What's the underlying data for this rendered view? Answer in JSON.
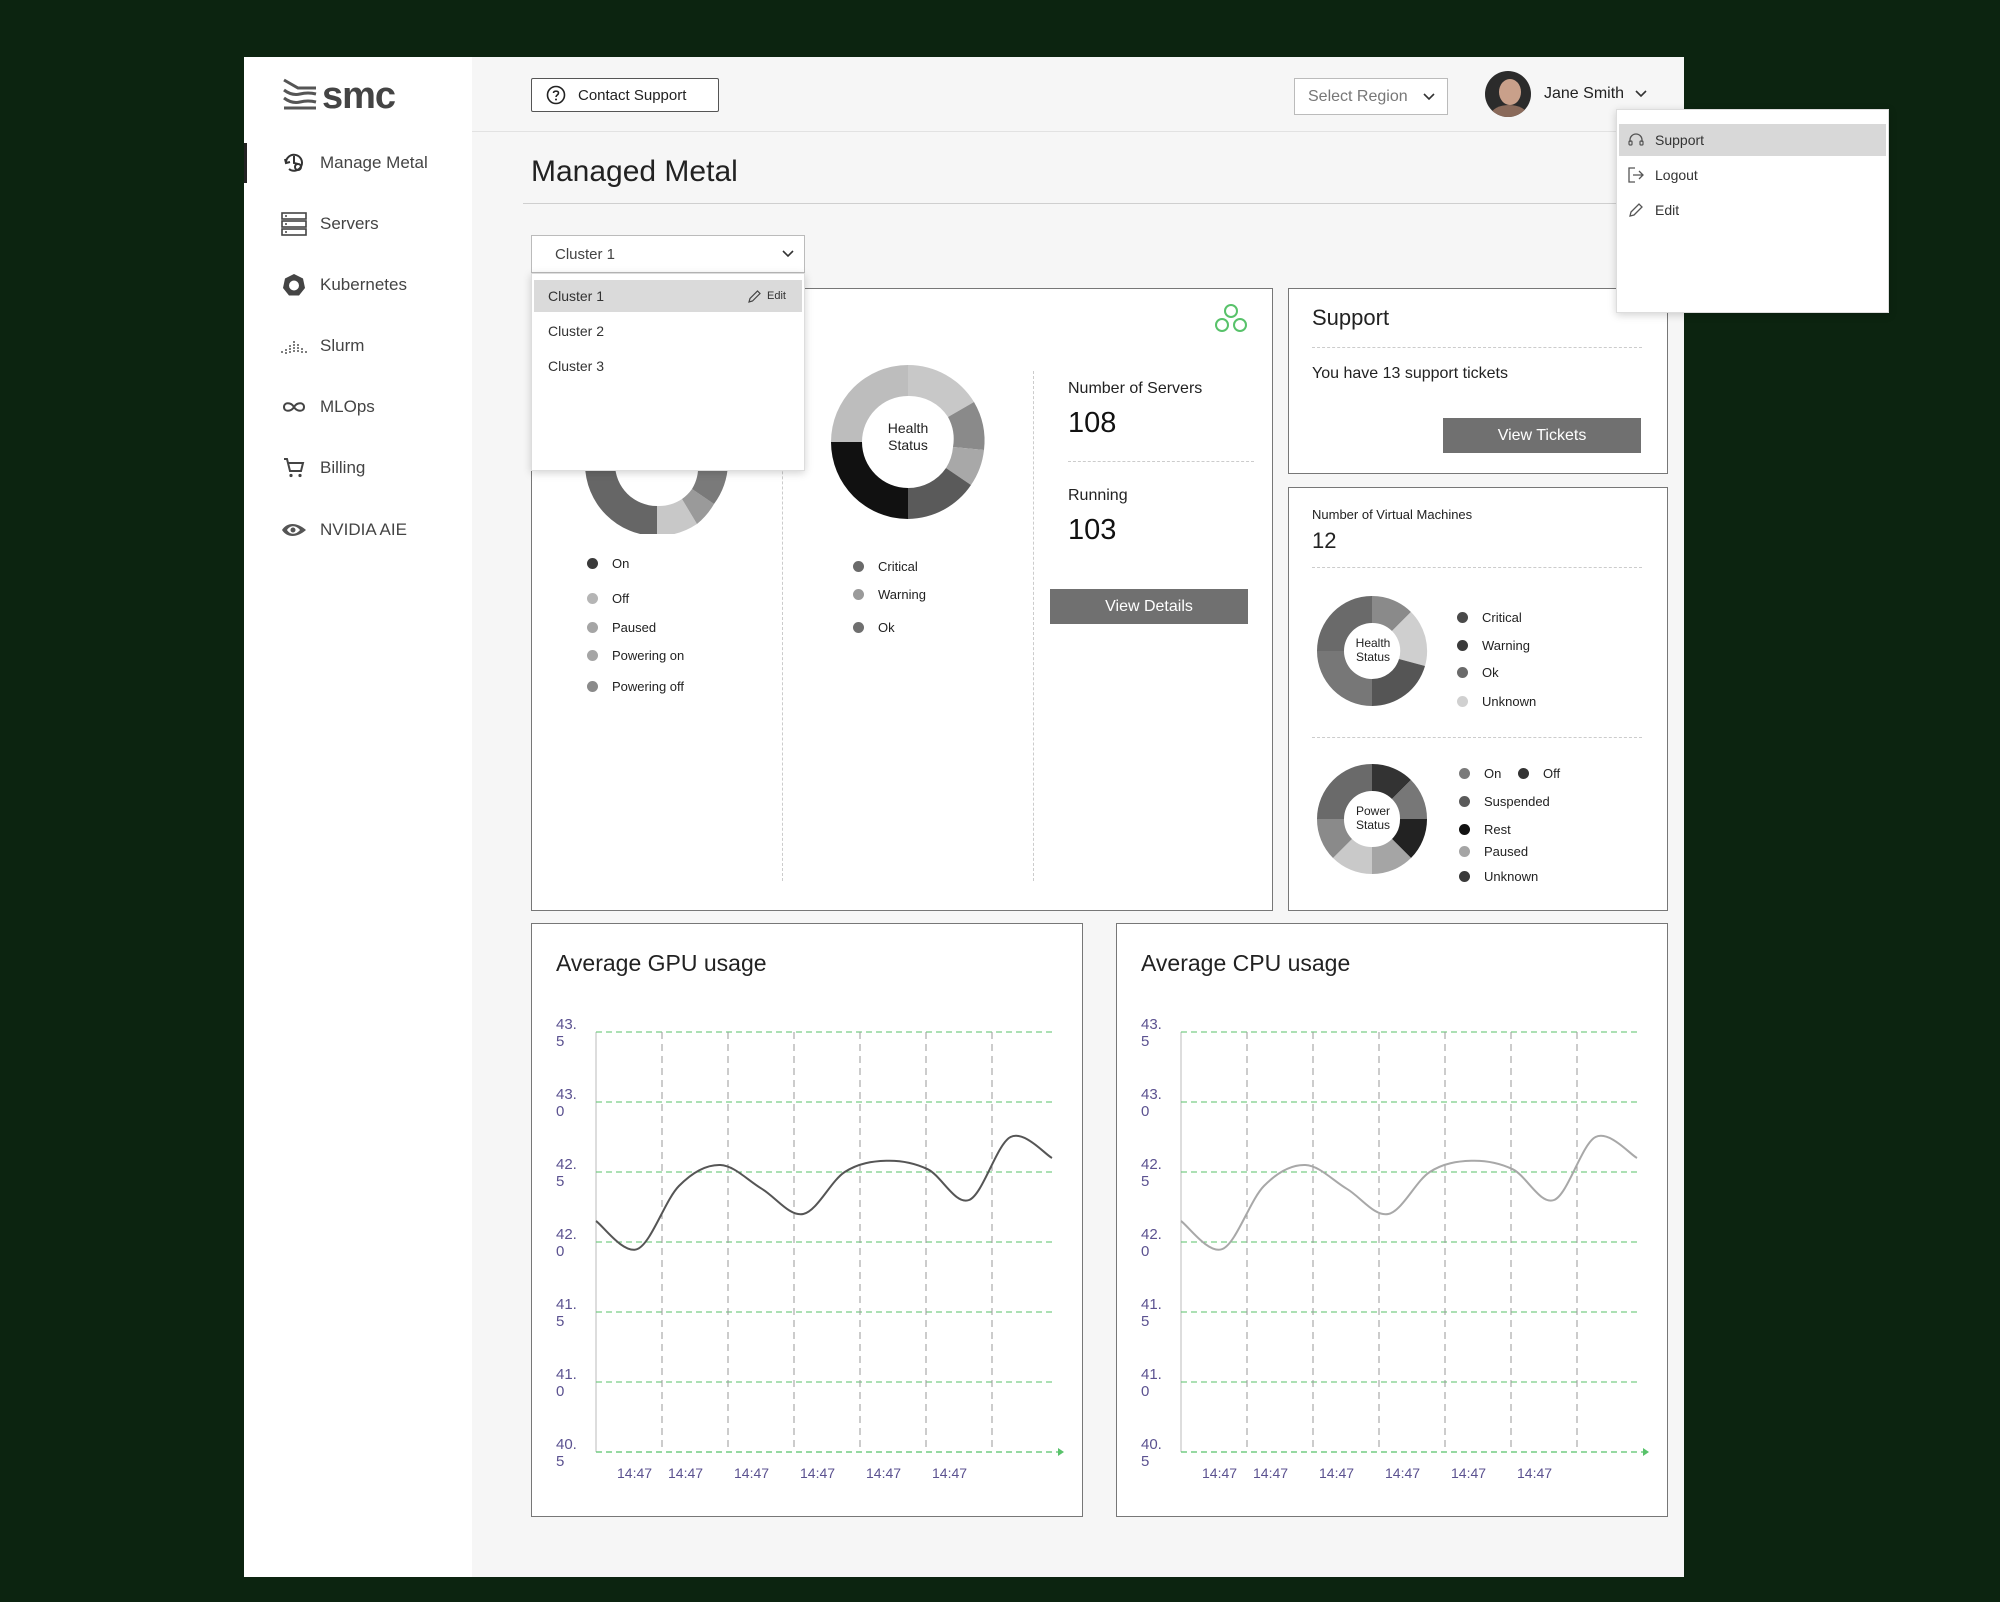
{
  "app": {
    "logo_text": "smc"
  },
  "sidebar": {
    "items": [
      {
        "label": "Manage Metal",
        "icon": "manage-metal-icon",
        "active": true
      },
      {
        "label": "Servers",
        "icon": "server-icon"
      },
      {
        "label": "Kubernetes",
        "icon": "kubernetes-icon"
      },
      {
        "label": "Slurm",
        "icon": "slurm-icon"
      },
      {
        "label": "MLOps",
        "icon": "infinity-icon"
      },
      {
        "label": "Billing",
        "icon": "cart-icon"
      },
      {
        "label": "NVIDIA AIE",
        "icon": "nvidia-icon"
      }
    ]
  },
  "header": {
    "contact_support": "Contact Support",
    "region_placeholder": "Select Region",
    "user_name": "Jane Smith"
  },
  "user_menu": {
    "items": [
      {
        "label": "Support",
        "icon": "support-icon",
        "highlighted": true
      },
      {
        "label": "Logout",
        "icon": "logout-icon"
      },
      {
        "label": "Edit",
        "icon": "pencil-icon"
      }
    ]
  },
  "page": {
    "title": "Managed Metal"
  },
  "cluster_select": {
    "value": "Cluster 1",
    "options": [
      {
        "label": "Cluster 1",
        "edit": "Edit",
        "selected": true
      },
      {
        "label": "Cluster 2"
      },
      {
        "label": "Cluster 3"
      }
    ]
  },
  "cluster_card": {
    "power_legend": [
      {
        "label": "On",
        "color": "#3a3a3a"
      },
      {
        "label": "Off",
        "color": "#b5b5b5"
      },
      {
        "label": "Paused",
        "color": "#a5a5a5"
      },
      {
        "label": "Powering on",
        "color": "#a5a5a5"
      },
      {
        "label": "Powering off",
        "color": "#8a8a8a"
      }
    ],
    "health_donut_label_1": "Health",
    "health_donut_label_2": "Status",
    "health_legend": [
      {
        "label": "Critical",
        "color": "#6a6a6a"
      },
      {
        "label": "Warning",
        "color": "#9a9a9a"
      },
      {
        "label": "Ok",
        "color": "#6f6f6f"
      }
    ],
    "servers_label": "Number of Servers",
    "servers_value": "108",
    "running_label": "Running",
    "running_value": "103",
    "view_details": "View Details"
  },
  "support_card": {
    "title": "Support",
    "text": "You have 13 support tickets",
    "button": "View Tickets"
  },
  "vm_card": {
    "label": "Number of Virtual Machines",
    "value": "12",
    "health_label_1": "Health",
    "health_label_2": "Status",
    "health_legend": [
      {
        "label": "Critical",
        "color": "#4a4a4a"
      },
      {
        "label": "Warning",
        "color": "#3a3a3a"
      },
      {
        "label": "Ok",
        "color": "#6a6a6a"
      },
      {
        "label": "Unknown",
        "color": "#d0d0d0"
      }
    ],
    "power_label_1": "Power",
    "power_label_2": "Status",
    "power_legend": [
      {
        "label": "On",
        "color": "#7a7a7a"
      },
      {
        "label": "Off",
        "color": "#333333"
      },
      {
        "label": "Suspended",
        "color": "#5a5a5a"
      },
      {
        "label": "Rest",
        "color": "#111111"
      },
      {
        "label": "Paused",
        "color": "#a5a5a5"
      },
      {
        "label": "Unknown",
        "color": "#3a3a3a"
      }
    ]
  },
  "colors": {
    "grid_green": "#58c26a",
    "tick_purple": "#5b5290",
    "gpu_line": "#555555",
    "cpu_line": "#a8a8a8"
  },
  "chart_data": [
    {
      "type": "line",
      "title": "Average GPU usage",
      "x": [
        "14:47",
        "14:47",
        "14:47",
        "14:47",
        "14:47",
        "14:47"
      ],
      "y_ticks": [
        "43.5",
        "43.0",
        "42.5",
        "42.0",
        "41.5",
        "41.0",
        "40.5"
      ],
      "ylim": [
        40.5,
        43.5
      ],
      "series": [
        {
          "values": [
            42.15,
            41.95,
            42.4,
            42.55,
            42.38,
            42.2,
            42.5,
            42.58,
            42.52,
            42.3,
            42.75,
            42.6
          ]
        }
      ],
      "grid": true
    },
    {
      "type": "line",
      "title": "Average CPU usage",
      "x": [
        "14:47",
        "14:47",
        "14:47",
        "14:47",
        "14:47",
        "14:47"
      ],
      "y_ticks": [
        "43.5",
        "43.0",
        "42.5",
        "42.0",
        "41.5",
        "41.0",
        "40.5"
      ],
      "ylim": [
        40.5,
        43.5
      ],
      "series": [
        {
          "values": [
            42.15,
            41.95,
            42.4,
            42.55,
            42.38,
            42.2,
            42.5,
            42.58,
            42.52,
            42.3,
            42.75,
            42.6
          ]
        }
      ],
      "grid": true
    }
  ]
}
